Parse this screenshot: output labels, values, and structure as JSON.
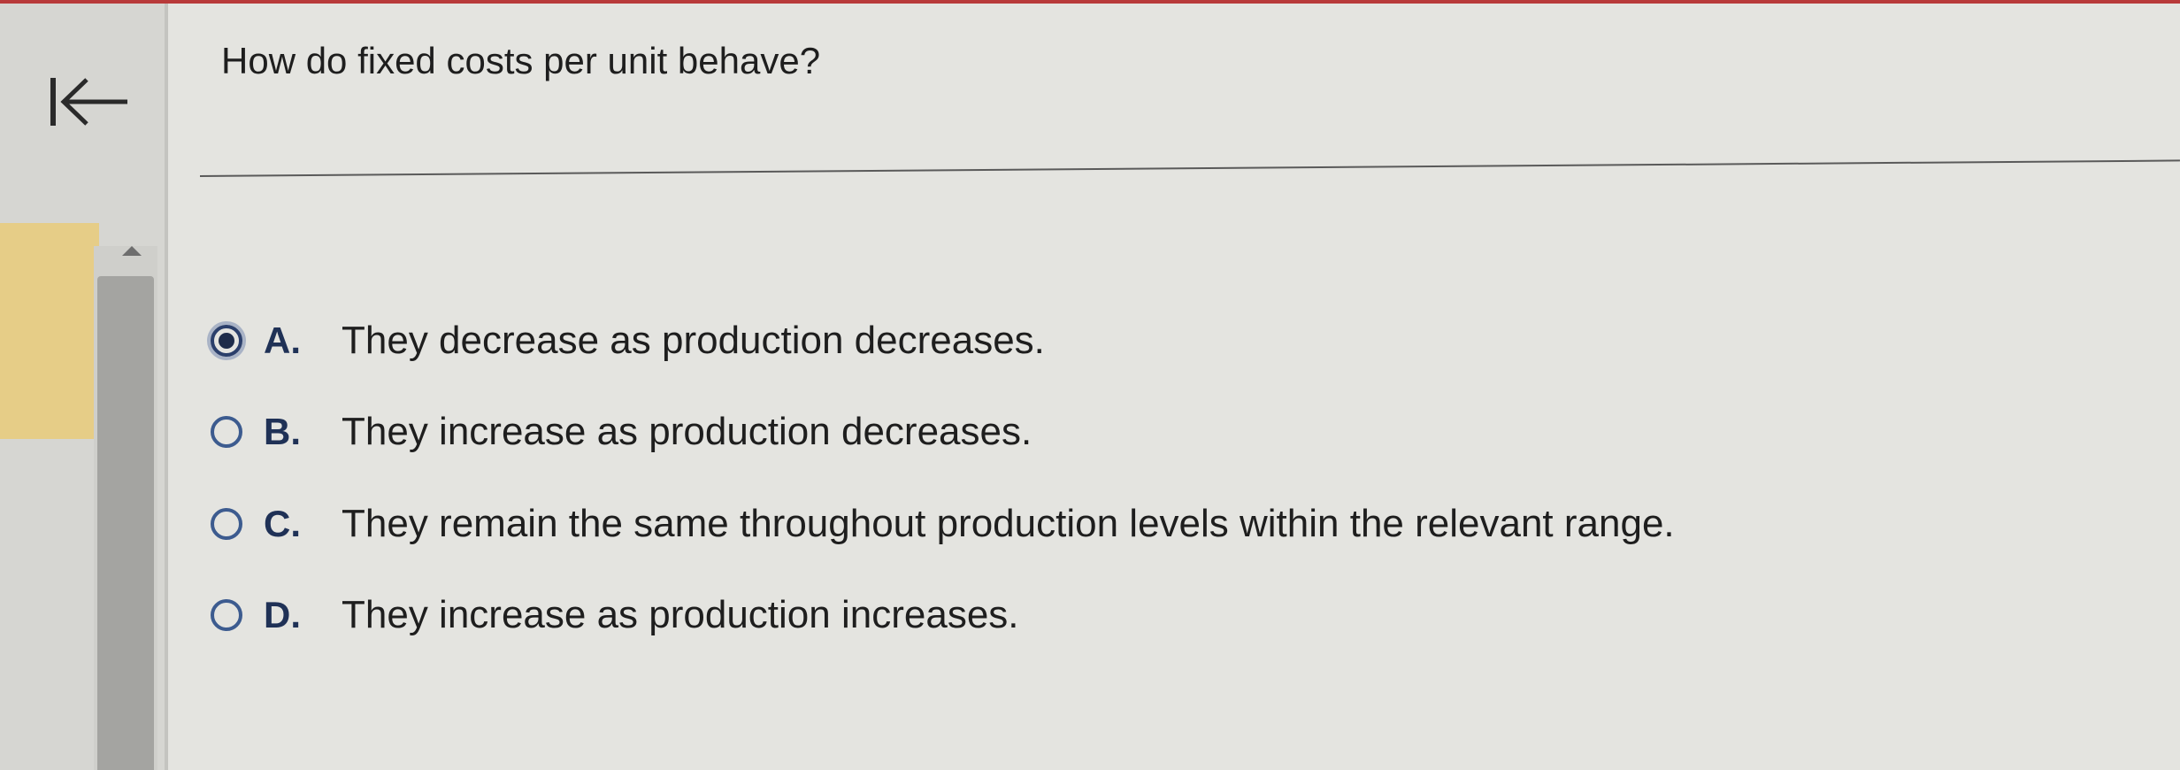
{
  "question": "How do fixed costs per unit behave?",
  "options": [
    {
      "letter": "A.",
      "text": "They decrease as production decreases.",
      "selected": true
    },
    {
      "letter": "B.",
      "text": "They increase as production decreases.",
      "selected": false
    },
    {
      "letter": "C.",
      "text": "They remain the same throughout production levels within the relevant range.",
      "selected": false
    },
    {
      "letter": "D.",
      "text": "They increase as production increases.",
      "selected": false
    }
  ],
  "icons": {
    "back": "back-to-start-icon",
    "scroll_up": "scroll-up-arrow-icon"
  },
  "colors": {
    "accent": "#2b3f6b",
    "highlight": "#e6cd87",
    "top_strip": "#b83a3a"
  }
}
